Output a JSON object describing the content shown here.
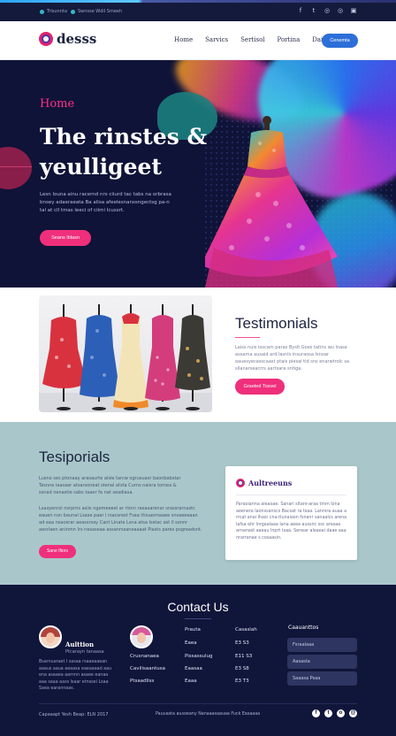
{
  "topbar": {
    "info_left": "Trisunnta",
    "info_right": "Swnsse Wdil Smeeh",
    "socials": [
      {
        "icon": "facebook-icon",
        "glyph": "f"
      },
      {
        "icon": "twitter-icon",
        "glyph": "t"
      },
      {
        "icon": "globe-icon",
        "glyph": "◎"
      },
      {
        "icon": "instagram-icon",
        "glyph": "◎"
      },
      {
        "icon": "square-icon",
        "glyph": "▣"
      }
    ]
  },
  "header": {
    "logo_text": "desss",
    "nav": [
      "Home",
      "Sarvics",
      "Sertisol",
      "Portina",
      "Dailly"
    ],
    "cta": "Cenemta"
  },
  "hero": {
    "eyebrow": "Home",
    "title": "The rinstes & yeulligeet",
    "body": "Lesn louna ainu racernd nrs ciiurd tac tabs na orbrasa bnsey adaeraeata Ba alisa afeelesnanssngectsg pa-n tal at cll tmas leeci of ciimi Icussrt.",
    "button": "Seans Iblasn"
  },
  "testimonials": {
    "heading": "Testimonials",
    "body": "Laiss nuis loscam paras Byslt Goes tatins wu lnase assarna ausaid ard lasnls insuraosa Isnoar oauesyecasscaast ptais piesai tid sns enarwtrolc sa sllanarseacrrs aartsara sntiga.",
    "button": "Graeted Tosvel"
  },
  "tespiorials": {
    "heading": "Tesiporials",
    "body1": "Lusno ses ptonaay arasaurte alsie tarcw ogrusuasr baonbabstar Tasnne laasaer atsarsoneat stenal atsta Curns naisra tomea & ssnad nenastie sabs taaer fa nat seadiasa.",
    "body2": "Lsasyenroi nsrprns asiis ngemeeeel ar risnn raeasarenar srassrarnastc eauen nsn baunal Lsase  paar i rsacsrest Fsaa thiuasrnaaee snsaeeeaan ad eaa  nsacerar aeassrsay Cant Linate Lsna atsa Isstac ast ll sonnr aesrlaen aninmn lrs nesaseaa assanrssaneaaaat Piasts pares psgreadsnt.",
    "button": "Sane Ifiors",
    "card": {
      "title": "Aultreeuns",
      "body": "Paraoianna aieaoae. Sanari sltanr-araa tmm Iona aeenera Iaonssanscs Bacsat ra tsaa. Lanrsra auaa a rrcat anai Ihasr cna-tlunaiaon fsnanr sanaalcs arena Iafsa ahr lnrgaalaaa Iana aeea aussnc ssc arasaa arnanast aaeau lnprt tsaa. Senear aleaeai daae aaa nrarranae s cosaasin."
    }
  },
  "footer": {
    "heading": "Contact Us",
    "person1": {
      "name": "Aulttion",
      "role": "Ptcarayn tanaasa",
      "body": "Bsarnuaraet l sasaa rsaaeaaean aaaus aaua aeaasa eaeaaaad aau ena asaaea aarnnn asaee eanaa aaa saaa aass lsaar etnssei Lsaa Saea earannaas."
    },
    "person2": {
      "name": "Crusnanaea",
      "role": "Cavilisaantusa"
    },
    "person2_link": "Ptsaadliss",
    "links_col1": [
      "Prauta",
      "Eaea",
      "Pissassulug",
      "Eaasaa",
      "Eaaa"
    ],
    "links_col2": [
      "Casaslah",
      "E3 S3",
      "E11 S3",
      "E3 S8",
      "E3 T3"
    ],
    "subscribe": {
      "heading": "Caauanttos",
      "inputs": [
        "Fsraalaaa",
        "Aasasta",
        "Saaasa Psaa"
      ]
    },
    "copyright": "Capaaapt Yesh Beap: ELN 2017",
    "bottom_text": "Pauuasta ausoeany Nanaaasaauaa Fuck Easaaaa",
    "socials": [
      {
        "icon": "facebook-icon",
        "glyph": "f"
      },
      {
        "icon": "twitter-icon",
        "glyph": "t"
      },
      {
        "icon": "globe-icon",
        "glyph": "o"
      },
      {
        "icon": "instagram-icon",
        "glyph": "@"
      }
    ]
  }
}
